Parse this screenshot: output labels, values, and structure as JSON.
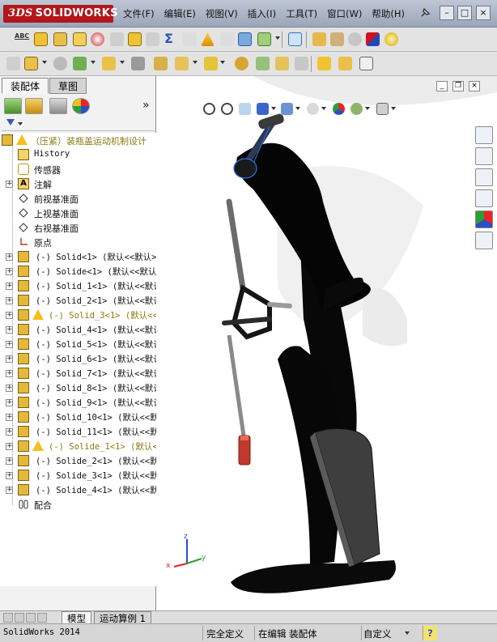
{
  "app": {
    "brand": "SOLIDWORKS",
    "brand_prefix": "3DS"
  },
  "menu": {
    "items": [
      {
        "label": "文件(F)"
      },
      {
        "label": "编辑(E)"
      },
      {
        "label": "视图(V)"
      },
      {
        "label": "插入(I)"
      },
      {
        "label": "工具(T)"
      },
      {
        "label": "窗口(W)"
      },
      {
        "label": "帮助(H)"
      }
    ]
  },
  "toolbar1": {
    "spell_label": "ABC"
  },
  "panel": {
    "tabs": [
      {
        "label": "装配体"
      },
      {
        "label": "草图"
      }
    ],
    "more": "»"
  },
  "tree": {
    "root": "（压紧）装瓶盖运动机制设计",
    "items": [
      {
        "label": "History",
        "icon": "history-icon"
      },
      {
        "label": "传感器",
        "icon": "sensor-icon"
      },
      {
        "label": "注解",
        "icon": "annotation-icon"
      },
      {
        "label": "前视基准面",
        "icon": "plane-icon"
      },
      {
        "label": "上视基准面",
        "icon": "plane-icon"
      },
      {
        "label": "右视基准面",
        "icon": "plane-icon"
      },
      {
        "label": "原点",
        "icon": "origin-icon"
      },
      {
        "label": "(-) Solid<1> (默认<<默认>",
        "warn": false
      },
      {
        "label": "(-) Solide<1> (默认<<默认",
        "warn": false
      },
      {
        "label": "(-) Solid_1<1> (默认<<默认",
        "warn": false
      },
      {
        "label": "(-) Solid_2<1> (默认<<默认",
        "warn": false
      },
      {
        "label": "(-) Solid_3<1> (默认<<",
        "warn": true
      },
      {
        "label": "(-) Solid_4<1> (默认<<默认",
        "warn": false
      },
      {
        "label": "(-) Solid_5<1> (默认<<默认",
        "warn": false
      },
      {
        "label": "(-) Solid_6<1> (默认<<默认",
        "warn": false
      },
      {
        "label": "(-) Solid_7<1> (默认<<默认",
        "warn": false
      },
      {
        "label": "(-) Solid_8<1> (默认<<默认",
        "warn": false
      },
      {
        "label": "(-) Solid_9<1> (默认<<默认",
        "warn": false
      },
      {
        "label": "(-) Solid_10<1> (默认<<默",
        "warn": false
      },
      {
        "label": "(-) Solid_11<1> (默认<<默",
        "warn": false
      },
      {
        "label": "(-) Solide_1<1> (默认<",
        "warn": true
      },
      {
        "label": "(-) Solide_2<1> (默认<<默",
        "warn": false
      },
      {
        "label": "(-) Solide_3<1> (默认<<默",
        "warn": false
      },
      {
        "label": "(-) Solide_4<1> (默认<<默",
        "warn": false
      },
      {
        "label": "配合",
        "icon": "mates-icon"
      }
    ]
  },
  "bottom_tabs": [
    {
      "label": "模型"
    },
    {
      "label": "运动算例 1"
    }
  ],
  "status": {
    "app_version": "SolidWorks 2014",
    "definition": "完全定义",
    "editing": "在编辑 装配体",
    "custom": "自定义",
    "help_symbol": "?"
  },
  "triad": {
    "x": "x",
    "y": "y",
    "z": "z"
  },
  "colors": {
    "brand_red": "#b2161b",
    "title_bar": "#aab4c5",
    "selection_blue": "#2f6fe0",
    "warning_yellow": "#f4c01e",
    "model_black": "#0a0a0a",
    "cap_red": "#c0392b"
  }
}
